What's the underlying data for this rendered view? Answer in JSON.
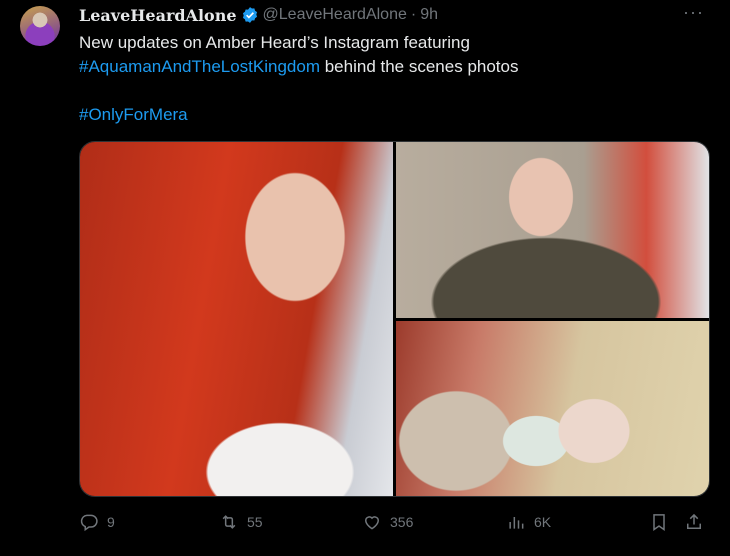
{
  "tweet": {
    "display_name": "LeaveHeardAlone",
    "verified_icon": "verified-badge-icon",
    "handle": "@LeaveHeardAlone",
    "separator": "·",
    "time": "9h",
    "more_icon": "more-horizontal-icon",
    "more_label": "···",
    "text": {
      "line1": "New updates on Amber Heard’s Instagram featuring",
      "hashtag1": "#AquamanAndTheLostKingdom",
      "line2_rest": " behind the scenes photos",
      "hashtag2": "#OnlyForMera"
    },
    "media": {
      "photos": [
        "red-hair-selfie",
        "car-selfie-sunglasses",
        "feeding-baby"
      ]
    },
    "actions": {
      "reply_count": "9",
      "retweet_count": "55",
      "like_count": "356",
      "views_count": "6K"
    }
  },
  "colors": {
    "background": "#000000",
    "text": "#e7e9ea",
    "muted": "#71767b",
    "accent": "#1d9bf0"
  }
}
